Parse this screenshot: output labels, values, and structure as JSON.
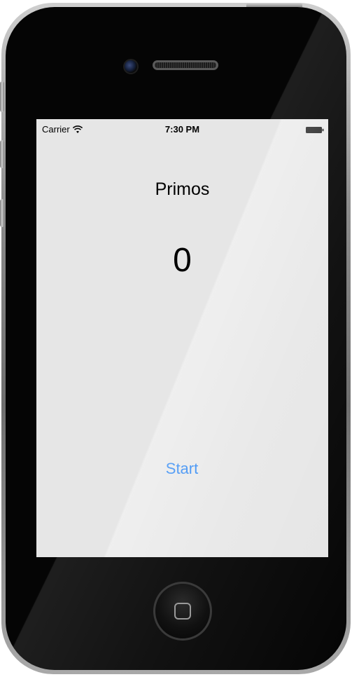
{
  "status_bar": {
    "carrier": "Carrier",
    "time": "7:30 PM",
    "wifi_icon": "wifi-icon",
    "battery_icon": "battery-icon"
  },
  "app": {
    "title": "Primos",
    "counter_value": "0",
    "start_label": "Start",
    "accent_color": "#1a7cf2"
  },
  "device": {
    "home_icon": "home-button-icon",
    "camera_icon": "camera-icon",
    "speaker_icon": "speaker-icon"
  }
}
